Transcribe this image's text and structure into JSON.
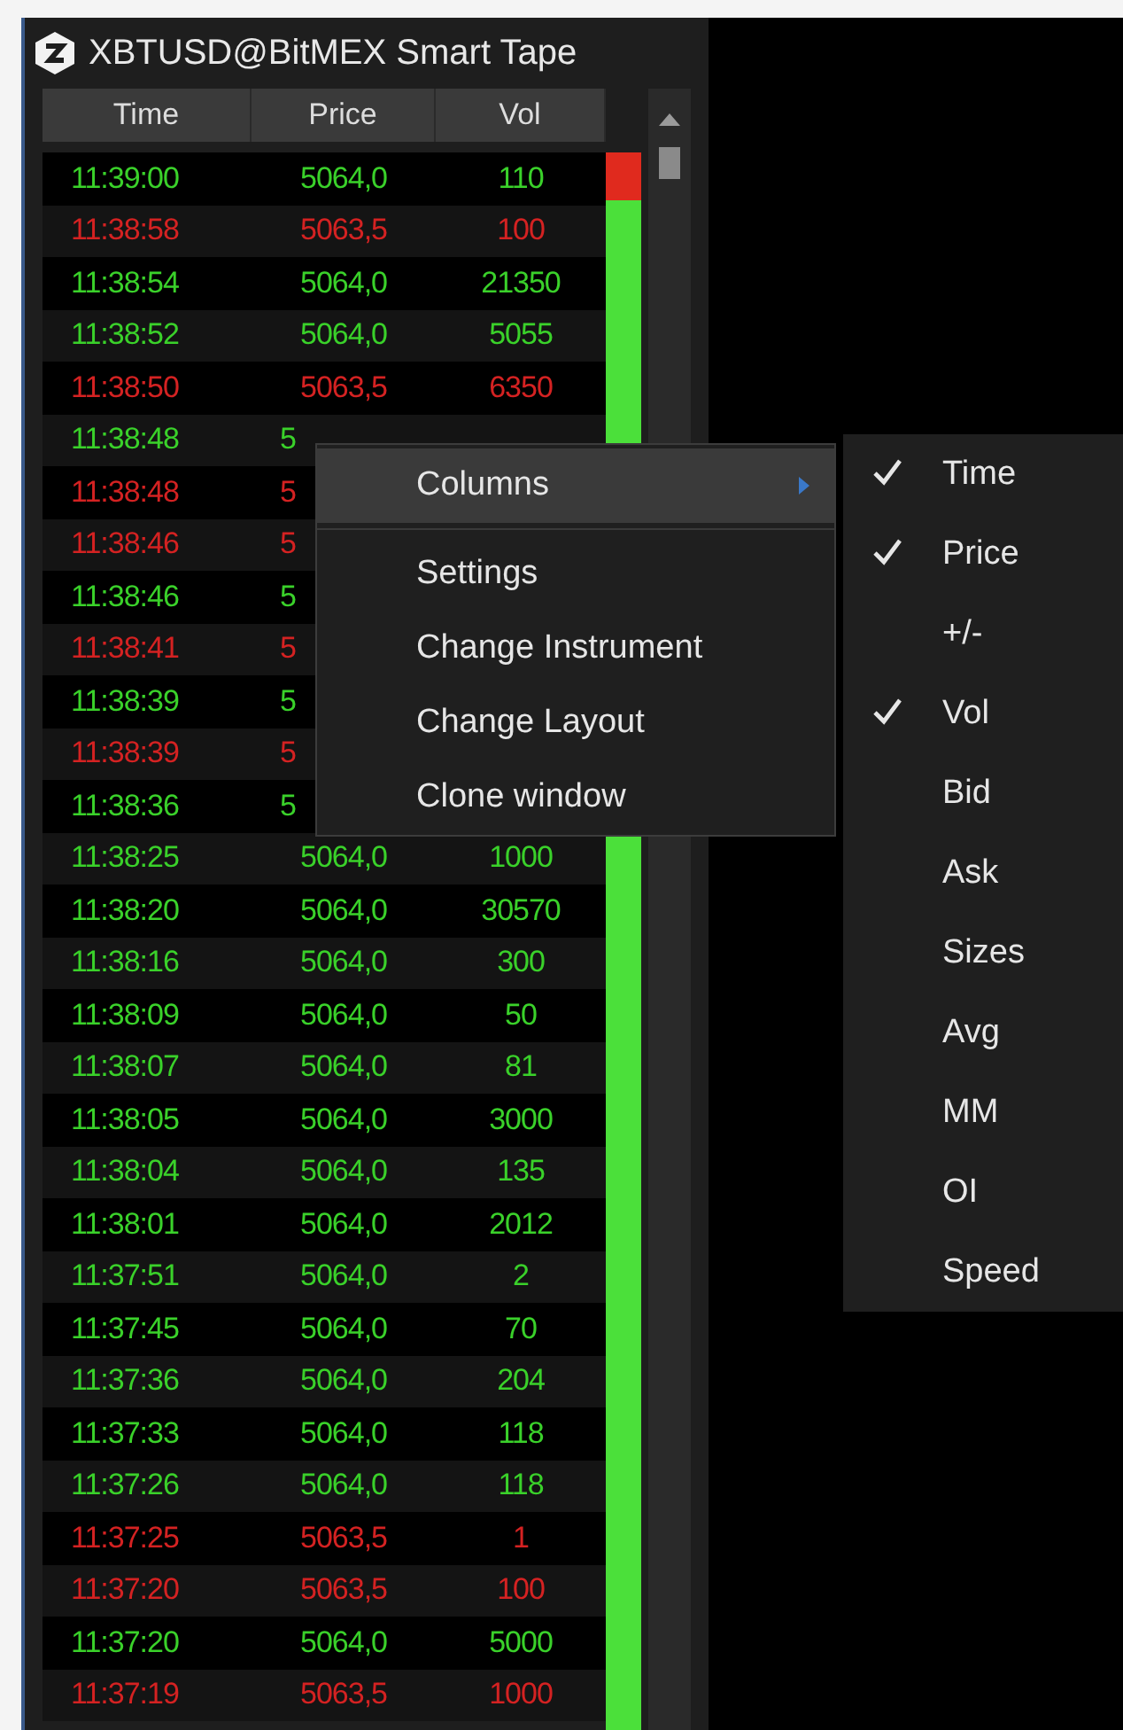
{
  "window": {
    "title": "XBTUSD@BitMEX Smart Tape"
  },
  "table": {
    "columns": [
      "Time",
      "Price",
      "Vol"
    ],
    "rows": [
      {
        "time": "11:39:00",
        "price": "5064,0",
        "vol": "110",
        "color": "#3ad12a"
      },
      {
        "time": "11:38:58",
        "price": "5063,5",
        "vol": "100",
        "color": "#d42222"
      },
      {
        "time": "11:38:54",
        "price": "5064,0",
        "vol": "21350",
        "color": "#3ad12a"
      },
      {
        "time": "11:38:52",
        "price": "5064,0",
        "vol": "5055",
        "color": "#3ad12a"
      },
      {
        "time": "11:38:50",
        "price": "5063,5",
        "vol": "6350",
        "color": "#d42222"
      },
      {
        "time": "11:38:48",
        "price": "5",
        "color": "#3ad12a"
      },
      {
        "time": "11:38:48",
        "price": "5",
        "color": "#d42222"
      },
      {
        "time": "11:38:46",
        "price": "5",
        "color": "#d42222"
      },
      {
        "time": "11:38:46",
        "price": "5",
        "color": "#3ad12a"
      },
      {
        "time": "11:38:41",
        "price": "5",
        "color": "#d42222"
      },
      {
        "time": "11:38:39",
        "price": "5",
        "color": "#3ad12a"
      },
      {
        "time": "11:38:39",
        "price": "5",
        "color": "#d42222"
      },
      {
        "time": "11:38:36",
        "price": "5",
        "color": "#3ad12a"
      },
      {
        "time": "11:38:25",
        "price": "5064,0",
        "vol": "1000",
        "color": "#3ad12a"
      },
      {
        "time": "11:38:20",
        "price": "5064,0",
        "vol": "30570",
        "color": "#3ad12a"
      },
      {
        "time": "11:38:16",
        "price": "5064,0",
        "vol": "300",
        "color": "#3ad12a"
      },
      {
        "time": "11:38:09",
        "price": "5064,0",
        "vol": "50",
        "color": "#3ad12a"
      },
      {
        "time": "11:38:07",
        "price": "5064,0",
        "vol": "81",
        "color": "#3ad12a"
      },
      {
        "time": "11:38:05",
        "price": "5064,0",
        "vol": "3000",
        "color": "#3ad12a"
      },
      {
        "time": "11:38:04",
        "price": "5064,0",
        "vol": "135",
        "color": "#3ad12a"
      },
      {
        "time": "11:38:01",
        "price": "5064,0",
        "vol": "2012",
        "color": "#3ad12a"
      },
      {
        "time": "11:37:51",
        "price": "5064,0",
        "vol": "2",
        "color": "#3ad12a"
      },
      {
        "time": "11:37:45",
        "price": "5064,0",
        "vol": "70",
        "color": "#3ad12a"
      },
      {
        "time": "11:37:36",
        "price": "5064,0",
        "vol": "204",
        "color": "#3ad12a"
      },
      {
        "time": "11:37:33",
        "price": "5064,0",
        "vol": "118",
        "color": "#3ad12a"
      },
      {
        "time": "11:37:26",
        "price": "5064,0",
        "vol": "118",
        "color": "#3ad12a"
      },
      {
        "time": "11:37:25",
        "price": "5063,5",
        "vol": "1",
        "color": "#d42222"
      },
      {
        "time": "11:37:20",
        "price": "5063,5",
        "vol": "100",
        "color": "#d42222"
      },
      {
        "time": "11:37:20",
        "price": "5064,0",
        "vol": "5000",
        "color": "#3ad12a"
      },
      {
        "time": "11:37:19",
        "price": "5063,5",
        "vol": "1000",
        "color": "#d42222"
      }
    ]
  },
  "volume_bar": {
    "level": 0.97
  },
  "context_menu": {
    "items": [
      {
        "kind": "submenu",
        "label": "Columns",
        "highlighted": true
      },
      {
        "kind": "separator"
      },
      {
        "kind": "item",
        "label": "Settings",
        "highlighted": false
      },
      {
        "kind": "item",
        "label": "Change Instrument",
        "highlighted": false
      },
      {
        "kind": "item",
        "label": "Change Layout",
        "highlighted": false
      },
      {
        "kind": "item",
        "label": "Clone window",
        "highlighted": false
      }
    ]
  },
  "columns_submenu": {
    "items": [
      {
        "label": "Time",
        "checked": true
      },
      {
        "label": "Price",
        "checked": true
      },
      {
        "label": "+/-",
        "checked": false
      },
      {
        "label": "Vol",
        "checked": true
      },
      {
        "label": "Bid",
        "checked": false
      },
      {
        "label": "Ask",
        "checked": false
      },
      {
        "label": "Sizes",
        "checked": false
      },
      {
        "label": "Avg",
        "checked": false
      },
      {
        "label": "MM",
        "checked": false
      },
      {
        "label": "OI",
        "checked": false
      },
      {
        "label": "Speed",
        "checked": false
      }
    ]
  }
}
